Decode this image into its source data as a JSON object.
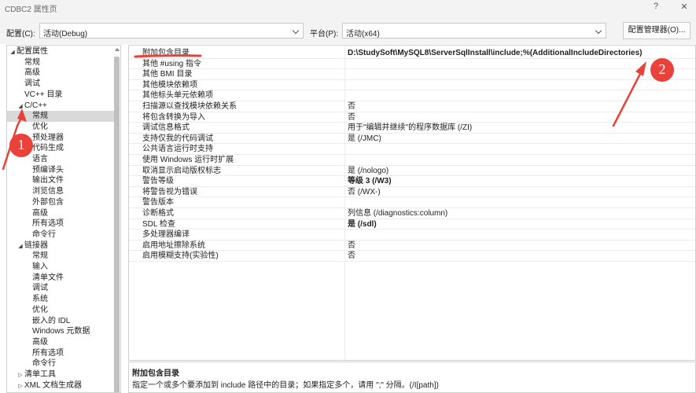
{
  "window": {
    "title": "CDBC2 属性页",
    "help_glyph": "?",
    "close_glyph": "✕"
  },
  "toolbar": {
    "config_label": "配置(C):",
    "config_value": "活动(Debug)",
    "platform_label": "平台(P):",
    "platform_value": "活动(x64)",
    "manager_button": "配置管理器(O)..."
  },
  "tree": {
    "items": [
      {
        "label": "配置属性",
        "level": 0,
        "arrow": "◢"
      },
      {
        "label": "常规",
        "level": 1
      },
      {
        "label": "高级",
        "level": 1
      },
      {
        "label": "调试",
        "level": 1
      },
      {
        "label": "VC++ 目录",
        "level": 1
      },
      {
        "label": "C/C++",
        "level": 1,
        "arrow": "◢"
      },
      {
        "label": "常规",
        "level": 2,
        "selected": true
      },
      {
        "label": "优化",
        "level": 2
      },
      {
        "label": "预处理器",
        "level": 2
      },
      {
        "label": "代码生成",
        "level": 2
      },
      {
        "label": "语言",
        "level": 2
      },
      {
        "label": "预编译头",
        "level": 2
      },
      {
        "label": "输出文件",
        "level": 2
      },
      {
        "label": "浏览信息",
        "level": 2
      },
      {
        "label": "外部包含",
        "level": 2
      },
      {
        "label": "高级",
        "level": 2
      },
      {
        "label": "所有选项",
        "level": 2
      },
      {
        "label": "命令行",
        "level": 2
      },
      {
        "label": "链接器",
        "level": 1,
        "arrow": "◢"
      },
      {
        "label": "常规",
        "level": 2
      },
      {
        "label": "输入",
        "level": 2
      },
      {
        "label": "清单文件",
        "level": 2
      },
      {
        "label": "调试",
        "level": 2
      },
      {
        "label": "系统",
        "level": 2
      },
      {
        "label": "优化",
        "level": 2
      },
      {
        "label": "嵌入的 IDL",
        "level": 2
      },
      {
        "label": "Windows 元数据",
        "level": 2
      },
      {
        "label": "高级",
        "level": 2
      },
      {
        "label": "所有选项",
        "level": 2
      },
      {
        "label": "命令行",
        "level": 2
      },
      {
        "label": "清单工具",
        "level": 1,
        "arrow": "▷"
      },
      {
        "label": "XML 文档生成器",
        "level": 1,
        "arrow": "▷"
      }
    ]
  },
  "grid": {
    "rows": [
      {
        "name": "附加包含目录",
        "value": "D:\\StudySoft\\MySQL8\\ServerSqlInstall\\include;%(AdditionalIncludeDirectories)",
        "bold": true
      },
      {
        "name": "其他 #using 指令",
        "value": ""
      },
      {
        "name": "其他 BMI 目录",
        "value": ""
      },
      {
        "name": "其他模块依赖项",
        "value": ""
      },
      {
        "name": "其他标头单元依赖项",
        "value": ""
      },
      {
        "name": "扫描源以查找模块依赖关系",
        "value": "否"
      },
      {
        "name": "将包含转换为导入",
        "value": "否"
      },
      {
        "name": "调试信息格式",
        "value": "用于\"编辑并继续\"的程序数据库 (/ZI)"
      },
      {
        "name": "支持仅我的代码调试",
        "value": "是 (/JMC)"
      },
      {
        "name": "公共语言运行时支持",
        "value": ""
      },
      {
        "name": "使用 Windows 运行时扩展",
        "value": ""
      },
      {
        "name": "取消显示启动版权标志",
        "value": "是 (/nologo)"
      },
      {
        "name": "警告等级",
        "value": "等级 3 (/W3)",
        "bold": true
      },
      {
        "name": "将警告视为错误",
        "value": "否 (/WX-)"
      },
      {
        "name": "警告版本",
        "value": ""
      },
      {
        "name": "诊断格式",
        "value": "列信息 (/diagnostics:column)"
      },
      {
        "name": "SDL 检查",
        "value": "是 (/sdl)",
        "bold": true
      },
      {
        "name": "多处理器编译",
        "value": ""
      },
      {
        "name": "启用地址擦除系统",
        "value": "否"
      },
      {
        "name": "启用模糊支持(实验性)",
        "value": "否"
      }
    ]
  },
  "description": {
    "title": "附加包含目录",
    "text": "指定一个或多个要添加到 include 路径中的目录；如果指定多个，请用 \";\" 分隔。(/I[path])"
  },
  "annotations": {
    "color": "#e8423a",
    "labels": [
      "1",
      "2"
    ]
  }
}
